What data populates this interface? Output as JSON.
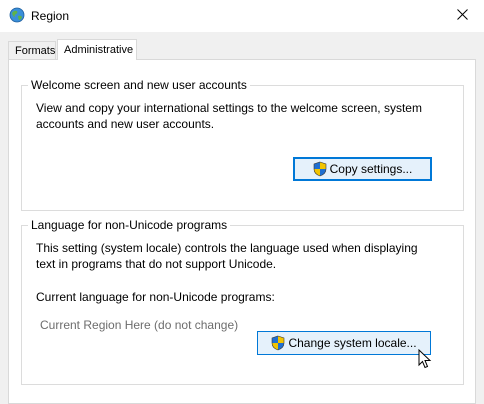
{
  "window": {
    "title": "Region",
    "title_icon": "globe-icon",
    "close_icon": "close-icon"
  },
  "tabs": [
    {
      "label": "Formats",
      "selected": false
    },
    {
      "label": "Administrative",
      "selected": true
    }
  ],
  "welcome_group": {
    "legend": "Welcome screen and new user accounts",
    "description_line1": "View and copy your international settings to the welcome screen, system",
    "description_line2": "accounts and new user accounts.",
    "button_label": "Copy settings...",
    "button_icon": "uac-shield-icon"
  },
  "unicode_group": {
    "legend": "Language for non-Unicode programs",
    "description_line1": "This setting (system locale) controls the language used when displaying",
    "description_line2": "text in programs that do not support Unicode.",
    "current_label": "Current language for non-Unicode programs:",
    "current_value": "Current Region Here (do not change)",
    "button_label": "Change system locale...",
    "button_icon": "uac-shield-icon"
  },
  "colors": {
    "focus_border": "#0078d7",
    "hover_background": "#e5f1fb",
    "window_background": "#f0f0f0"
  }
}
